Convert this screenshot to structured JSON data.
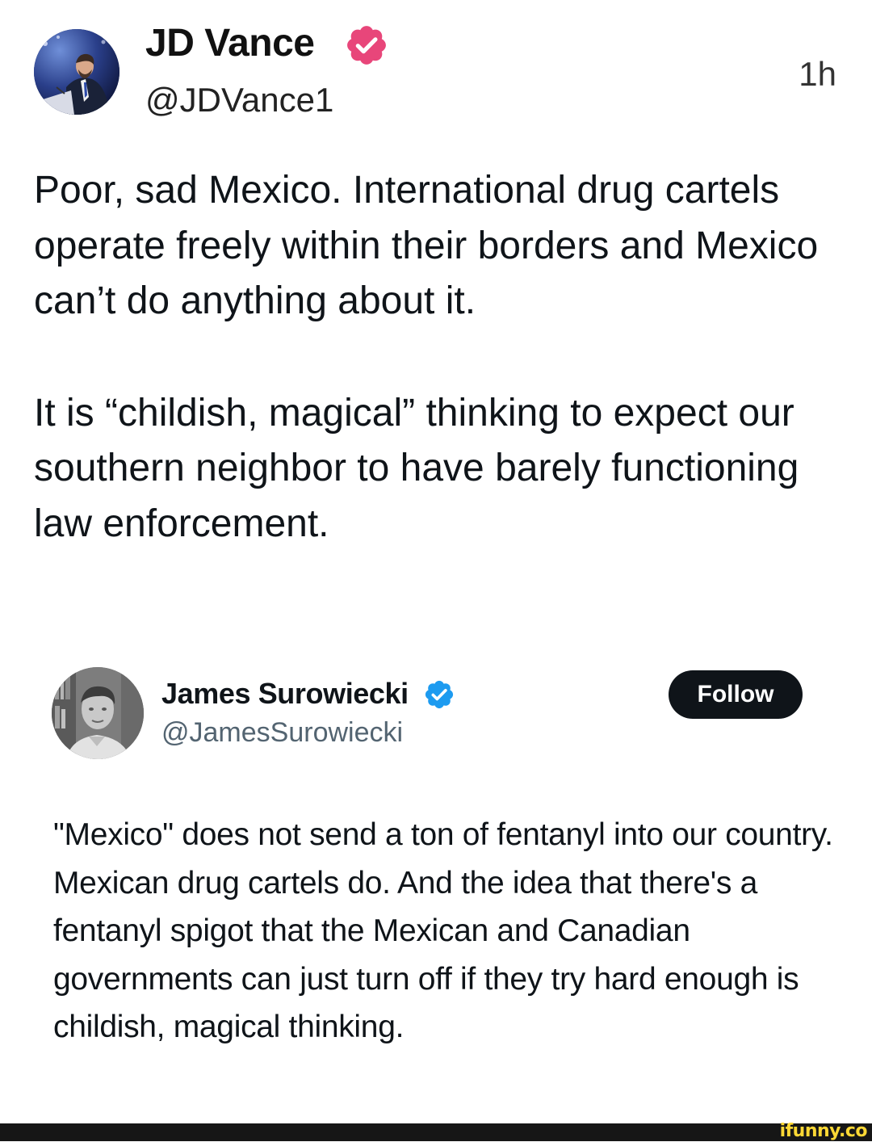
{
  "post": {
    "author_name": "JD Vance",
    "author_handle": "@JDVance1",
    "timestamp": "1h",
    "badge_color": "#e8467a",
    "paragraph_1": "Poor, sad Mexico. International drug cartels operate freely within their borders and Mexico can’t do anything about it.",
    "paragraph_2": "It is “childish, magical” thinking to expect our southern neighbor to have barely functioning law enforcement."
  },
  "quoted": {
    "author_name": "James Surowiecki",
    "author_handle": "@JamesSurowiecki",
    "follow_label": "Follow",
    "badge_color": "#1d9bf0",
    "text": "\"Mexico\" does not send a ton of fentanyl into our country. Mexican drug cartels do. And the idea that there's a fentanyl spigot that the Mexican and Canadian governments can just turn off if they try hard enough is childish, magical thinking."
  },
  "footer": {
    "watermark": "ifunny.co",
    "watermark_color": "#fdd835"
  }
}
